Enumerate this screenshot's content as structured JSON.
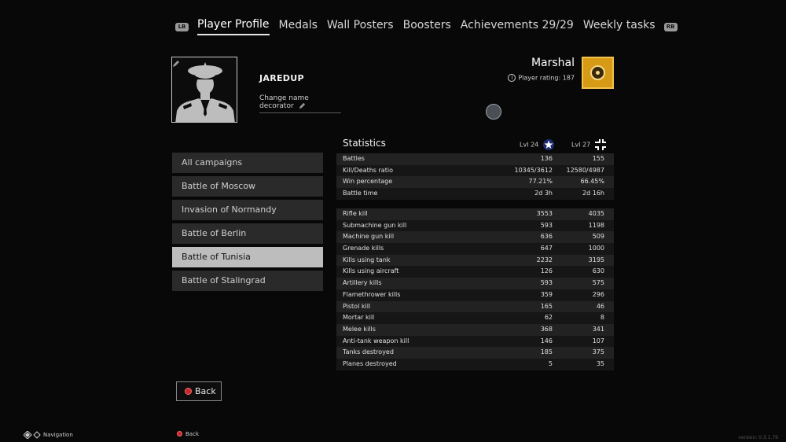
{
  "tabs": {
    "left_bumper": "LB",
    "right_bumper": "RB",
    "items": [
      {
        "label": "Player Profile"
      },
      {
        "label": "Medals"
      },
      {
        "label": "Wall Posters"
      },
      {
        "label": "Boosters"
      },
      {
        "label": "Achievements 29/29"
      },
      {
        "label": "Weekly tasks"
      }
    ]
  },
  "profile": {
    "username": "JAREDUP",
    "decorator_label": "Change name decorator",
    "rank": "Marshal",
    "rating_label": "Player rating: 187"
  },
  "campaigns": [
    {
      "label": "All campaigns"
    },
    {
      "label": "Battle of Moscow"
    },
    {
      "label": "Invasion of Normandy"
    },
    {
      "label": "Battle of Berlin"
    },
    {
      "label": "Battle of Tunisia",
      "selected": true
    },
    {
      "label": "Battle of Stalingrad"
    }
  ],
  "stats": {
    "title": "Statistics",
    "allies_level": "Lvl 24",
    "axis_level": "Lvl 27",
    "general": [
      {
        "label": "Battles",
        "a": "136",
        "b": "155"
      },
      {
        "label": "Kill/Deaths ratio",
        "a": "10345/3612",
        "b": "12580/4987"
      },
      {
        "label": "Win percentage",
        "a": "77.21%",
        "b": "66.45%"
      },
      {
        "label": "Battle time",
        "a": "2d 3h",
        "b": "2d 16h"
      }
    ],
    "kills": [
      {
        "label": "Rifle kill",
        "a": "3553",
        "b": "4035"
      },
      {
        "label": "Submachine gun kill",
        "a": "593",
        "b": "1198"
      },
      {
        "label": "Machine gun kill",
        "a": "636",
        "b": "509"
      },
      {
        "label": "Grenade kills",
        "a": "647",
        "b": "1000"
      },
      {
        "label": "Kills using tank",
        "a": "2232",
        "b": "3195"
      },
      {
        "label": "Kills using aircraft",
        "a": "126",
        "b": "630"
      },
      {
        "label": "Artillery kills",
        "a": "593",
        "b": "575"
      },
      {
        "label": "Flamethrower kills",
        "a": "359",
        "b": "296"
      },
      {
        "label": "Pistol kill",
        "a": "165",
        "b": "46"
      },
      {
        "label": "Mortar kill",
        "a": "62",
        "b": "8"
      },
      {
        "label": "Melee kills",
        "a": "368",
        "b": "341"
      },
      {
        "label": "Anti-tank weapon kill",
        "a": "146",
        "b": "107"
      },
      {
        "label": "Tanks destroyed",
        "a": "185",
        "b": "375"
      },
      {
        "label": "Planes destroyed",
        "a": "5",
        "b": "35"
      }
    ]
  },
  "buttons": {
    "back": "Back"
  },
  "footer": {
    "navigation": "Navigation",
    "back": "Back",
    "version": "version: 0.3.1.79"
  },
  "colors": {
    "background": "#080808",
    "panel": "#2a2a2a",
    "selected": "#bdbdbd",
    "medal_gold": "#d79a16",
    "back_dot": "#c8262b"
  }
}
